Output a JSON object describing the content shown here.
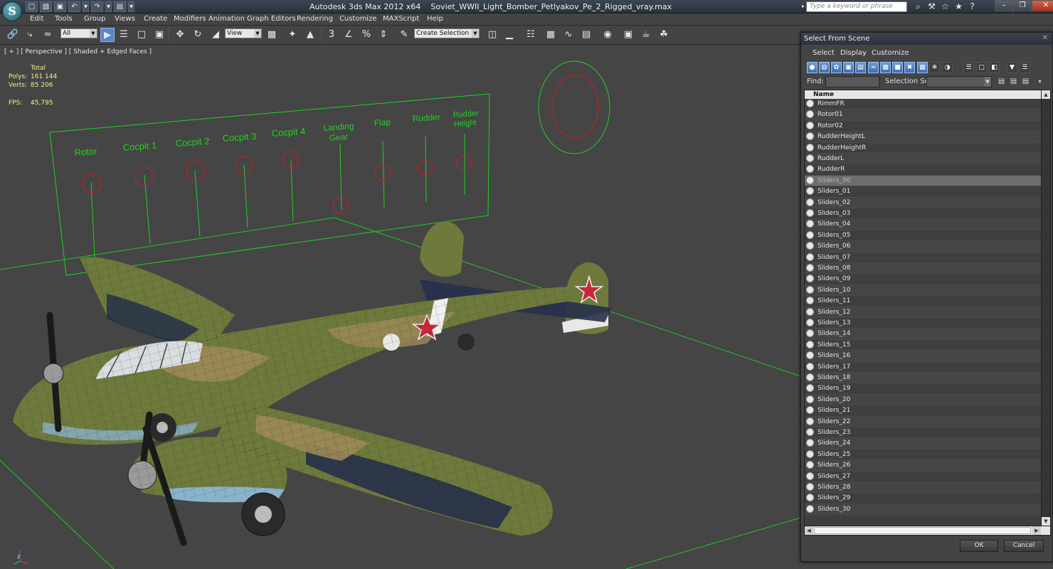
{
  "app": {
    "logo_glyph": "S",
    "title_product": "Autodesk 3ds Max  2012 x64",
    "title_file": "Soviet_WWII_Light_Bomber_Petlyakov_Pe_2_Rigged_vray.max",
    "search_placeholder": "Type a keyword or phrase"
  },
  "quick_access": [
    "□",
    "▧",
    "▣",
    "↶",
    "▾",
    "↷",
    "▾",
    "▤",
    "▾"
  ],
  "title_icons": [
    "⌕",
    "⚒",
    "☆",
    "★",
    "?"
  ],
  "menu": {
    "items": [
      "Edit",
      "Tools",
      "Group",
      "Views",
      "Create",
      "Modifiers",
      "Animation",
      "Graph Editors",
      "Rendering",
      "Customize",
      "MAXScript",
      "Help"
    ]
  },
  "toolbar": {
    "filter_value": "All",
    "refcoord_value": "View",
    "named_selection_value": "Create Selection Se",
    "snap_label": "3"
  },
  "viewport": {
    "label": "[ + ] [ Perspective ] [ Shaded + Edged Faces ]",
    "stats": {
      "total_label": "Total",
      "polys_label": "Polys:",
      "polys_value": "161 144",
      "verts_label": "Verts:",
      "verts_value": "85 206",
      "fps_label": "FPS:",
      "fps_value": "45,795"
    },
    "rig_labels": [
      "Rotor",
      "Cocpit 1",
      "Cocpit 2",
      "Cocpit 3",
      "Cocpit 4",
      "Landing",
      "Gear",
      "Flap",
      "Rudder",
      "Rudder",
      "Height"
    ],
    "colors": {
      "rig_green": "#1fd21f",
      "handle_red": "#d41c1c",
      "camo_olive": "#6e7a3c",
      "camo_tan": "#9c8a56",
      "camo_navy": "#26304a",
      "belly_blue": "#8ab2cc",
      "star_red": "#c8283a"
    }
  },
  "dialog": {
    "title": "Select From Scene",
    "menu": [
      "Select",
      "Display",
      "Customize"
    ],
    "find_label": "Find:",
    "find_value": "",
    "selection_set_label": "Selection Set:",
    "column_name": "Name",
    "items": [
      "RimmFR",
      "Rotor01",
      "Rotor02",
      "RudderHeightL",
      "RudderHeightR",
      "RudderL",
      "RudderR",
      "Sliders_00",
      "Sliders_01",
      "Sliders_02",
      "Sliders_03",
      "Sliders_04",
      "Sliders_05",
      "Sliders_06",
      "Sliders_07",
      "Sliders_08",
      "Sliders_09",
      "Sliders_10",
      "Sliders_11",
      "Sliders_12",
      "Sliders_13",
      "Sliders_14",
      "Sliders_15",
      "Sliders_16",
      "Sliders_17",
      "Sliders_18",
      "Sliders_19",
      "Sliders_20",
      "Sliders_21",
      "Sliders_22",
      "Sliders_23",
      "Sliders_24",
      "Sliders_25",
      "Sliders_26",
      "Sliders_27",
      "Sliders_28",
      "Sliders_29",
      "Sliders_30"
    ],
    "selected_item": "Sliders_00",
    "ok_label": "OK",
    "cancel_label": "Cancel"
  }
}
